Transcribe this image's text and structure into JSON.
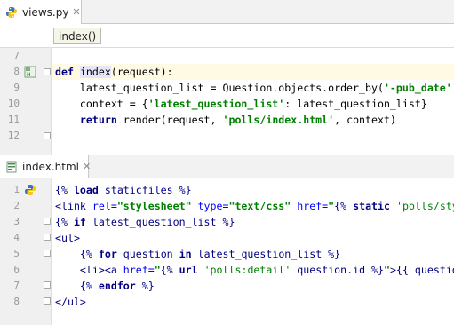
{
  "top_pane": {
    "tab": {
      "label": "views.py",
      "icon": "python-file-icon"
    },
    "breadcrumb": {
      "label": "index()"
    },
    "lines": [
      {
        "no": "7",
        "code": ""
      },
      {
        "no": "8",
        "code": "def index(request):"
      },
      {
        "no": "9",
        "code": "    latest_question_list = Question.objects.order_by('-pub_date')"
      },
      {
        "no": "10",
        "code": "    context = {'latest_question_list': latest_question_list}"
      },
      {
        "no": "11",
        "code": "    return render(request, 'polls/index.html', context)"
      },
      {
        "no": "12",
        "code": ""
      }
    ],
    "highlight_color": "#fffae3"
  },
  "bottom_pane": {
    "tab": {
      "label": "index.html",
      "icon": "html-file-icon"
    },
    "lines": [
      {
        "no": "1",
        "code": "{% load staticfiles %}"
      },
      {
        "no": "2",
        "code": "<link rel=\"stylesheet\" type=\"text/css\" href=\"{% static 'polls/style.css' %}\" />"
      },
      {
        "no": "3",
        "code": "{% if latest_question_list %}"
      },
      {
        "no": "4",
        "code": "<ul>"
      },
      {
        "no": "5",
        "code": "    {% for question in latest_question_list %}"
      },
      {
        "no": "6",
        "code": "    <li><a href=\"{% url 'polls:detail' question.id %}\">{{ question.question_text }}</a></li>"
      },
      {
        "no": "7",
        "code": "    {% endfor %}"
      },
      {
        "no": "8",
        "code": "</ul>"
      }
    ]
  }
}
